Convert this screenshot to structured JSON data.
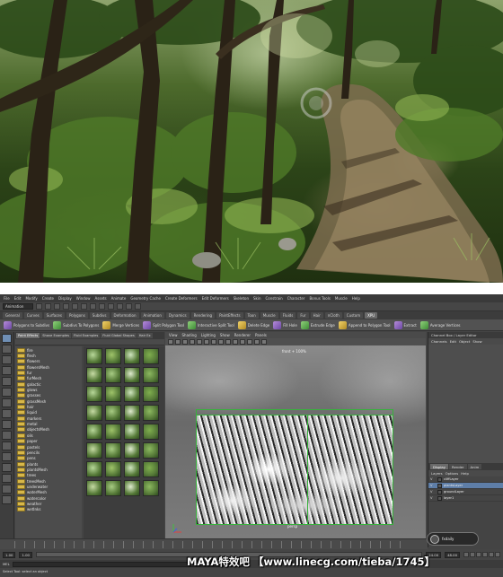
{
  "maya": {
    "menu": [
      "File",
      "Edit",
      "Modify",
      "Create",
      "Display",
      "Window",
      "Assets",
      "Animate",
      "Geometry Cache",
      "Create Deformers",
      "Edit Deformers",
      "Skeleton",
      "Skin",
      "Constrain",
      "Character",
      "Bonus Tools",
      "Muscle",
      "Help"
    ],
    "mode": "Animation",
    "shelf_tabs": [
      "General",
      "Curves",
      "Surfaces",
      "Polygons",
      "Subdivs",
      "Deformation",
      "Animation",
      "Dynamics",
      "Rendering",
      "PaintEffects",
      "Toon",
      "Muscle",
      "Fluids",
      "Fur",
      "Hair",
      "nCloth",
      "Custom",
      "XPU"
    ],
    "active_shelf_tab": "XPU",
    "shelf_tools": [
      "Polygons to Subdivs",
      "Subdivs To Polygons",
      "Merge Vertices",
      "Split Polygon Tool",
      "Interactive Split Tool",
      "Delete Edge",
      "Fill Hole",
      "Extrude Edge",
      "Append to Polygon Tool",
      "Extract",
      "Average Vertices"
    ],
    "browser_tabs": [
      "Paint Effects",
      "Shave Examples",
      "Fluid Examples",
      "Fluid Global Shapes",
      "Hair Ex"
    ],
    "browser_folders": [
      "fire",
      "flesh",
      "flowers",
      "flowersMesh",
      "fur",
      "furMesh",
      "galactic",
      "glows",
      "grasses",
      "grassMesh",
      "hair",
      "liquid",
      "markers",
      "metal",
      "objectsMesh",
      "oils",
      "paper",
      "pastels",
      "pencils",
      "pens",
      "plants",
      "plantsMesh",
      "trees",
      "treesMesh",
      "underwater",
      "waterMesh",
      "watercolor",
      "weather",
      "wetInks"
    ],
    "viewport_menu": [
      "View",
      "Shading",
      "Lighting",
      "Show",
      "Renderer",
      "Panels"
    ],
    "camera_label": "front + 100%",
    "persp_label": "persp",
    "channel_title": "Channel Box / Layer Editor",
    "channel_menu": [
      "Channels",
      "Edit",
      "Object",
      "Show"
    ],
    "layer_tabs": [
      "Display",
      "Render",
      "Anim"
    ],
    "layer_menu": [
      "Layers",
      "Options",
      "Help"
    ],
    "layers": [
      {
        "v": "V",
        "name": "cliffLayer"
      },
      {
        "v": "V",
        "name": "plantsLayer"
      },
      {
        "v": "V",
        "name": "groundLayer"
      },
      {
        "v": "V",
        "name": "layer1"
      }
    ],
    "range_start": "1.00",
    "range_end_inner": "24.00",
    "range_end": "48.00",
    "current_start": "1.00",
    "mel_label": "MEL",
    "help_text": "Select Tool: select an object"
  },
  "overlay": {
    "corner_badge": "fxdaily",
    "watermark": "MAYA特效吧  【www.linecg.com/tieba/1745】"
  },
  "colors": {
    "selection_green": "#37b23c",
    "layer_highlight": "#5e7ea8",
    "folder_yellow": "#d8b84a"
  }
}
